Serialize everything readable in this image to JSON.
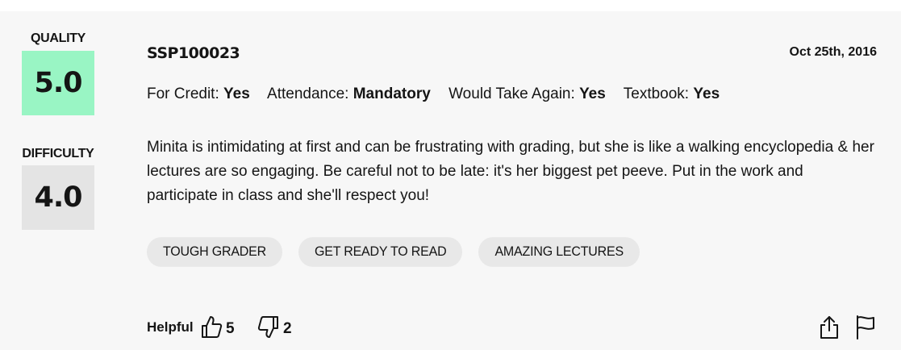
{
  "ratings": {
    "quality": {
      "label": "QUALITY",
      "value": "5.0",
      "color": "#99f5c4"
    },
    "difficulty": {
      "label": "DIFFICULTY",
      "value": "4.0",
      "color": "#e4e4e4"
    }
  },
  "review": {
    "course": "SSP100023",
    "date": "Oct 25th, 2016",
    "meta": [
      {
        "label": "For Credit:",
        "value": "Yes"
      },
      {
        "label": "Attendance:",
        "value": "Mandatory"
      },
      {
        "label": "Would Take Again:",
        "value": "Yes"
      },
      {
        "label": "Textbook:",
        "value": "Yes"
      }
    ],
    "comment": "Minita is intimidating at first and can be frustrating with grading, but she is like a walking encyclopedia & her lectures are so engaging. Be careful not to be late: it's her biggest pet peeve. Put in the work and participate in class and she'll respect you!",
    "tags": [
      "TOUGH GRADER",
      "GET READY TO READ",
      "AMAZING LECTURES"
    ]
  },
  "footer": {
    "helpful_label": "Helpful",
    "thumbs_up": {
      "icon": "thumbs-up-icon",
      "count": "5"
    },
    "thumbs_down": {
      "icon": "thumbs-down-icon",
      "count": "2"
    },
    "share_icon": "share-icon",
    "flag_icon": "flag-icon"
  }
}
